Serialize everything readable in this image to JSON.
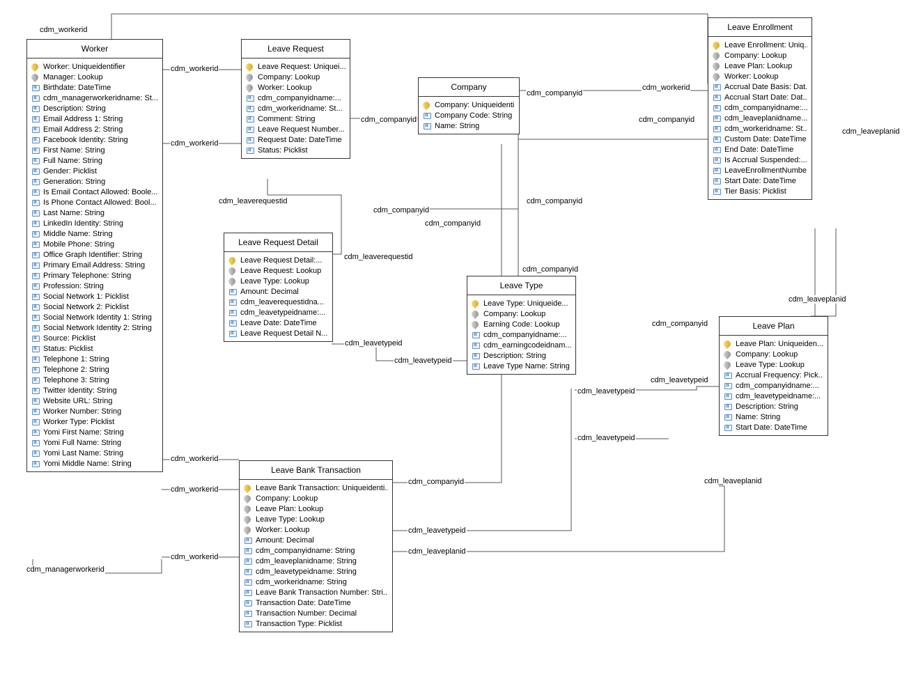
{
  "entities": {
    "worker": {
      "title": "Worker",
      "attrs": [
        {
          "k": "pk",
          "t": "Worker: Uniqueidentifier"
        },
        {
          "k": "fk",
          "t": "Manager: Lookup"
        },
        {
          "k": "f",
          "t": "Birthdate: DateTime"
        },
        {
          "k": "f",
          "t": "cdm_managerworkeridname: St..."
        },
        {
          "k": "f",
          "t": "Description: String"
        },
        {
          "k": "f",
          "t": "Email Address 1: String"
        },
        {
          "k": "f",
          "t": "Email Address 2: String"
        },
        {
          "k": "f",
          "t": "Facebook Identity: String"
        },
        {
          "k": "f",
          "t": "First Name: String"
        },
        {
          "k": "f",
          "t": "Full Name: String"
        },
        {
          "k": "f",
          "t": "Gender: Picklist"
        },
        {
          "k": "f",
          "t": "Generation: String"
        },
        {
          "k": "f",
          "t": "Is Email Contact Allowed: Boole..."
        },
        {
          "k": "f",
          "t": "Is Phone Contact Allowed: Bool..."
        },
        {
          "k": "f",
          "t": "Last Name: String"
        },
        {
          "k": "f",
          "t": "LinkedIn Identity: String"
        },
        {
          "k": "f",
          "t": "Middle Name: String"
        },
        {
          "k": "f",
          "t": "Mobile Phone: String"
        },
        {
          "k": "f",
          "t": "Office Graph Identifier: String"
        },
        {
          "k": "f",
          "t": "Primary Email Address: String"
        },
        {
          "k": "f",
          "t": "Primary Telephone: String"
        },
        {
          "k": "f",
          "t": "Profession: String"
        },
        {
          "k": "f",
          "t": "Social Network 1: Picklist"
        },
        {
          "k": "f",
          "t": "Social Network 2: Picklist"
        },
        {
          "k": "f",
          "t": "Social Network Identity 1: String"
        },
        {
          "k": "f",
          "t": "Social Network Identity 2: String"
        },
        {
          "k": "f",
          "t": "Source: Picklist"
        },
        {
          "k": "f",
          "t": "Status: Picklist"
        },
        {
          "k": "f",
          "t": "Telephone 1: String"
        },
        {
          "k": "f",
          "t": "Telephone 2: String"
        },
        {
          "k": "f",
          "t": "Telephone 3: String"
        },
        {
          "k": "f",
          "t": "Twitter Identity: String"
        },
        {
          "k": "f",
          "t": "Website URL: String"
        },
        {
          "k": "f",
          "t": "Worker Number: String"
        },
        {
          "k": "f",
          "t": "Worker Type: Picklist"
        },
        {
          "k": "f",
          "t": "Yomi First Name: String"
        },
        {
          "k": "f",
          "t": "Yomi Full Name: String"
        },
        {
          "k": "f",
          "t": "Yomi Last Name: String"
        },
        {
          "k": "f",
          "t": "Yomi Middle Name: String"
        }
      ]
    },
    "leaveRequest": {
      "title": "Leave Request",
      "attrs": [
        {
          "k": "pk",
          "t": "Leave Request: Uniquei..."
        },
        {
          "k": "fk",
          "t": "Company: Lookup"
        },
        {
          "k": "fk",
          "t": "Worker: Lookup"
        },
        {
          "k": "f",
          "t": "cdm_companyidname:..."
        },
        {
          "k": "f",
          "t": "cdm_workeridname: St..."
        },
        {
          "k": "f",
          "t": "Comment: String"
        },
        {
          "k": "f",
          "t": "Leave Request Number..."
        },
        {
          "k": "f",
          "t": "Request Date: DateTime"
        },
        {
          "k": "f",
          "t": "Status: Picklist"
        }
      ]
    },
    "company": {
      "title": "Company",
      "attrs": [
        {
          "k": "pk",
          "t": "Company: Uniqueidenti..."
        },
        {
          "k": "f",
          "t": "Company Code: String"
        },
        {
          "k": "f",
          "t": "Name: String"
        }
      ]
    },
    "leaveEnrollment": {
      "title": "Leave Enrollment",
      "attrs": [
        {
          "k": "pk",
          "t": "Leave Enrollment: Uniq..."
        },
        {
          "k": "fk",
          "t": "Company: Lookup"
        },
        {
          "k": "fk",
          "t": "Leave Plan: Lookup"
        },
        {
          "k": "fk",
          "t": "Worker: Lookup"
        },
        {
          "k": "f",
          "t": "Accrual Date Basis: Dat..."
        },
        {
          "k": "f",
          "t": "Accrual Start Date: Dat..."
        },
        {
          "k": "f",
          "t": "cdm_companyidname:..."
        },
        {
          "k": "f",
          "t": "cdm_leaveplanidname..."
        },
        {
          "k": "f",
          "t": "cdm_workeridname: St..."
        },
        {
          "k": "f",
          "t": "Custom Date: DateTime"
        },
        {
          "k": "f",
          "t": "End Date: DateTime"
        },
        {
          "k": "f",
          "t": "Is Accrual Suspended:..."
        },
        {
          "k": "f",
          "t": "LeaveEnrollmentNumbe..."
        },
        {
          "k": "f",
          "t": "Start Date: DateTime"
        },
        {
          "k": "f",
          "t": "Tier Basis: Picklist"
        }
      ]
    },
    "leaveRequestDetail": {
      "title": "Leave Request Detail",
      "attrs": [
        {
          "k": "pk",
          "t": "Leave Request Detail:..."
        },
        {
          "k": "fk",
          "t": "Leave Request: Lookup"
        },
        {
          "k": "fk",
          "t": "Leave Type: Lookup"
        },
        {
          "k": "f",
          "t": "Amount: Decimal"
        },
        {
          "k": "f",
          "t": "cdm_leaverequestidna..."
        },
        {
          "k": "f",
          "t": "cdm_leavetypeidname:..."
        },
        {
          "k": "f",
          "t": "Leave Date: DateTime"
        },
        {
          "k": "f",
          "t": "Leave Request Detail N..."
        }
      ]
    },
    "leaveType": {
      "title": "Leave Type",
      "attrs": [
        {
          "k": "pk",
          "t": "Leave Type: Uniqueide..."
        },
        {
          "k": "fk",
          "t": "Company: Lookup"
        },
        {
          "k": "fk",
          "t": "Earning Code: Lookup"
        },
        {
          "k": "f",
          "t": "cdm_companyidname:..."
        },
        {
          "k": "f",
          "t": "cdm_earningcodeidnam..."
        },
        {
          "k": "f",
          "t": "Description: String"
        },
        {
          "k": "f",
          "t": "Leave Type Name: String"
        }
      ]
    },
    "leavePlan": {
      "title": "Leave Plan",
      "attrs": [
        {
          "k": "pk",
          "t": "Leave Plan: Uniqueiden..."
        },
        {
          "k": "fk",
          "t": "Company: Lookup"
        },
        {
          "k": "fk",
          "t": "Leave Type: Lookup"
        },
        {
          "k": "f",
          "t": "Accrual Frequency: Pick..."
        },
        {
          "k": "f",
          "t": "cdm_companyidname:..."
        },
        {
          "k": "f",
          "t": "cdm_leavetypeidname:..."
        },
        {
          "k": "f",
          "t": "Description: String"
        },
        {
          "k": "f",
          "t": "Name: String"
        },
        {
          "k": "f",
          "t": "Start Date: DateTime"
        }
      ]
    },
    "leaveBankTransaction": {
      "title": "Leave Bank Transaction",
      "attrs": [
        {
          "k": "pk",
          "t": "Leave Bank Transaction: Uniqueidenti..."
        },
        {
          "k": "fk",
          "t": "Company: Lookup"
        },
        {
          "k": "fk",
          "t": "Leave Plan: Lookup"
        },
        {
          "k": "fk",
          "t": "Leave Type: Lookup"
        },
        {
          "k": "fk",
          "t": "Worker: Lookup"
        },
        {
          "k": "f",
          "t": "Amount: Decimal"
        },
        {
          "k": "f",
          "t": "cdm_companyidname: String"
        },
        {
          "k": "f",
          "t": "cdm_leaveplanidname: String"
        },
        {
          "k": "f",
          "t": "cdm_leavetypeidname: String"
        },
        {
          "k": "f",
          "t": "cdm_workeridname: String"
        },
        {
          "k": "f",
          "t": "Leave Bank Transaction Number: Stri..."
        },
        {
          "k": "f",
          "t": "Transaction Date: DateTime"
        },
        {
          "k": "f",
          "t": "Transaction Number: Decimal"
        },
        {
          "k": "f",
          "t": "Transaction Type: Picklist"
        }
      ]
    }
  },
  "labels": {
    "l1": "cdm_workerid",
    "l2": "cdm_workerid",
    "l3": "cdm_workerid",
    "l4": "cdm_workerid",
    "l5": "cdm_workerid",
    "l6": "cdm_workerid",
    "l7": "cdm_workerid",
    "l8": "cdm_managerworkerid",
    "l9": "cdm_leaverequestid",
    "l10": "cdm_leaverequestid",
    "l11": "cdm_companyid",
    "l12": "cdm_companyid",
    "l13": "cdm_companyid",
    "l14": "cdm_companyid",
    "l15": "cdm_companyid",
    "l16": "cdm_companyid",
    "l17": "cdm_companyid",
    "l18": "cdm_companyid",
    "l19": "cdm_leavetypeid",
    "l20": "cdm_leavetypeid",
    "l21": "cdm_leavetypeid",
    "l22": "cdm_leavetypeid",
    "l23": "cdm_leavetypeid",
    "l24": "cdm_leaveplanid",
    "l25": "cdm_leaveplanid",
    "l26": "cdm_leaveplanid"
  }
}
